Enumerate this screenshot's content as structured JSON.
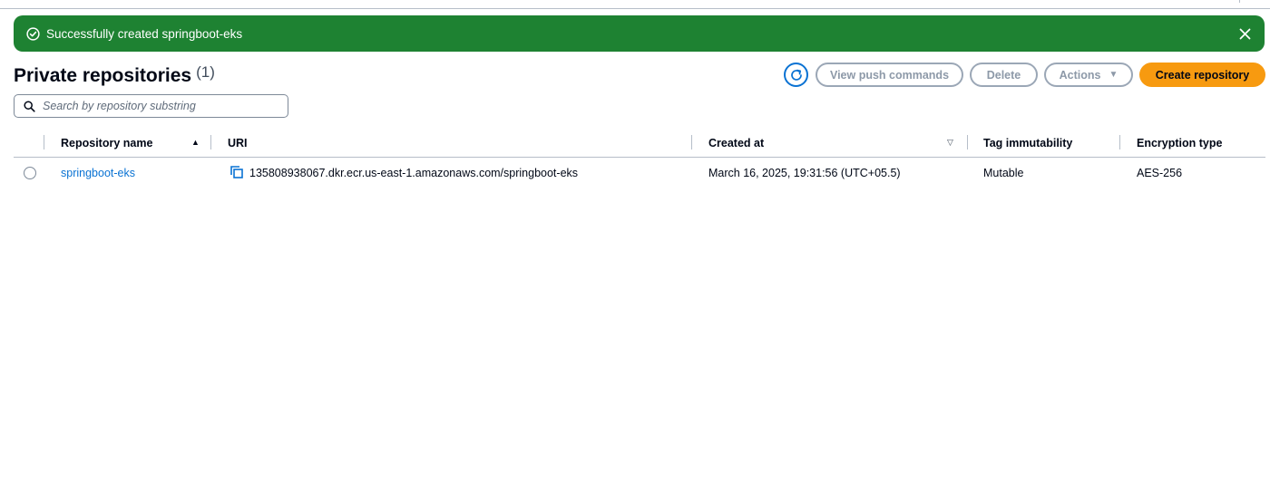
{
  "flash": {
    "message": "Successfully created springboot-eks",
    "icon": "check-circle-icon",
    "close_icon": "close-icon",
    "color": "#1e8232"
  },
  "header": {
    "title": "Private repositories",
    "count": "(1)",
    "buttons": {
      "refresh_icon": "refresh-icon",
      "view_push_commands": "View push commands",
      "delete": "Delete",
      "actions": "Actions",
      "create_repository": "Create repository"
    },
    "accent_color": "#f79a10",
    "link_color": "#0972d3"
  },
  "search": {
    "placeholder": "Search by repository substring",
    "value": ""
  },
  "table": {
    "columns": [
      "Repository name",
      "URI",
      "Created at",
      "Tag immutability",
      "Encryption type"
    ],
    "rows": [
      {
        "name": "springboot-eks",
        "uri": "135808938067.dkr.ecr.us-east-1.amazonaws.com/springboot-eks",
        "created_at": "March 16, 2025, 19:31:56 (UTC+05.5)",
        "tag_immutability": "Mutable",
        "encryption_type": "AES-256"
      }
    ]
  }
}
